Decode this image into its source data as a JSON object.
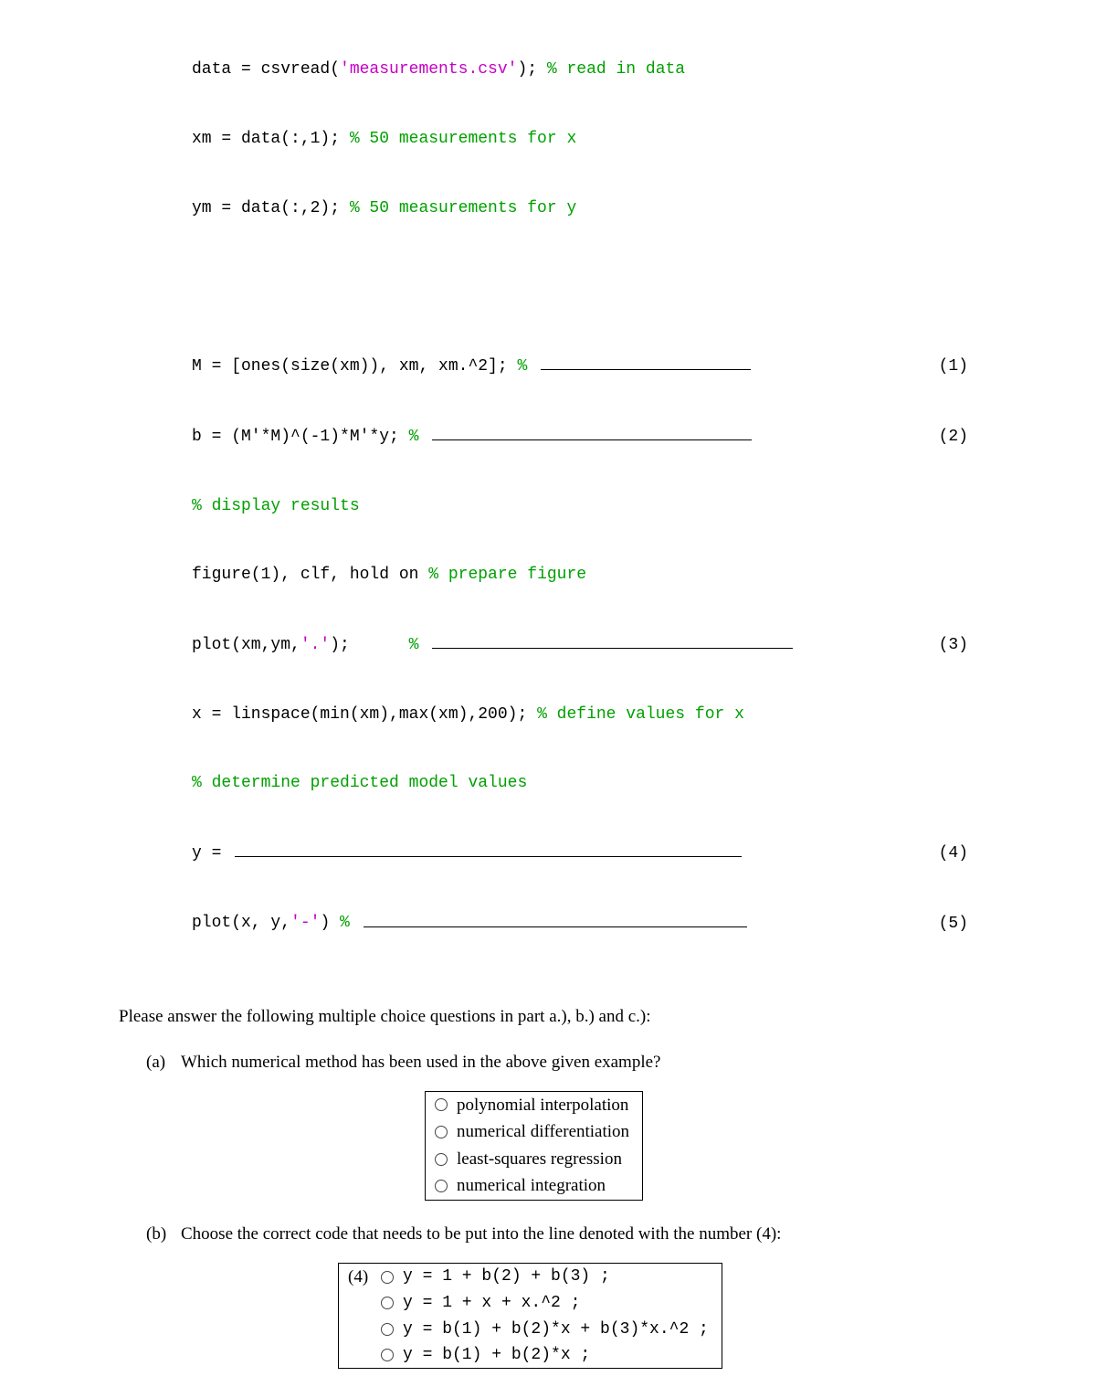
{
  "code": {
    "l1a": "data = csvread(",
    "l1s": "'measurements.csv'",
    "l1b": "); ",
    "l1c": "% read in data",
    "l2a": "xm = data(:,1); ",
    "l2c": "% 50 measurements for x",
    "l3a": "ym = data(:,2); ",
    "l3c": "% 50 measurements for y",
    "l4a": "M = [ones(size(xm)), xm, xm.^2]; ",
    "l4p": "% ",
    "l4n": "(1)",
    "l5a": "b = (M'*M)^(-1)*M'*y; ",
    "l5p": "% ",
    "l5n": "(2)",
    "l6c": "% display results",
    "l7a": "figure(1), clf, hold on ",
    "l7c": "% prepare figure",
    "l8a": "plot(xm,ym,",
    "l8s": "'.'",
    "l8b": ");      ",
    "l8p": "% ",
    "l8n": "(3)",
    "l9a": "x = linspace(min(xm),max(xm),200); ",
    "l9c": "% define values for x",
    "l10c": "% determine predicted model values",
    "l11a": "y = ",
    "l11n": "(4)",
    "l12a": "plot(x, y,",
    "l12s": "'-'",
    "l12b": ") ",
    "l12p": "% ",
    "l12n": "(5)"
  },
  "instruction": "Please answer the following multiple choice questions in part a.), b.) and c.):",
  "qa": {
    "label": "(a)",
    "text": "Which numerical method has been used in the above given example?",
    "options": [
      "polynomial interpolation",
      "numerical differentiation",
      "least-squares regression",
      "numerical integration"
    ]
  },
  "qb": {
    "label": "(b)",
    "text": "Choose the correct code that needs to be put into the line denoted with the number (4):",
    "rowlabel": "(4)",
    "options_code": [
      "y = 1 + b(2) + b(3) ;",
      "y = 1 + x + x.^2 ;",
      "y = b(1) + b(2)*x + b(3)*x.^2 ;",
      "y = b(1) + b(2)*x ;"
    ]
  }
}
